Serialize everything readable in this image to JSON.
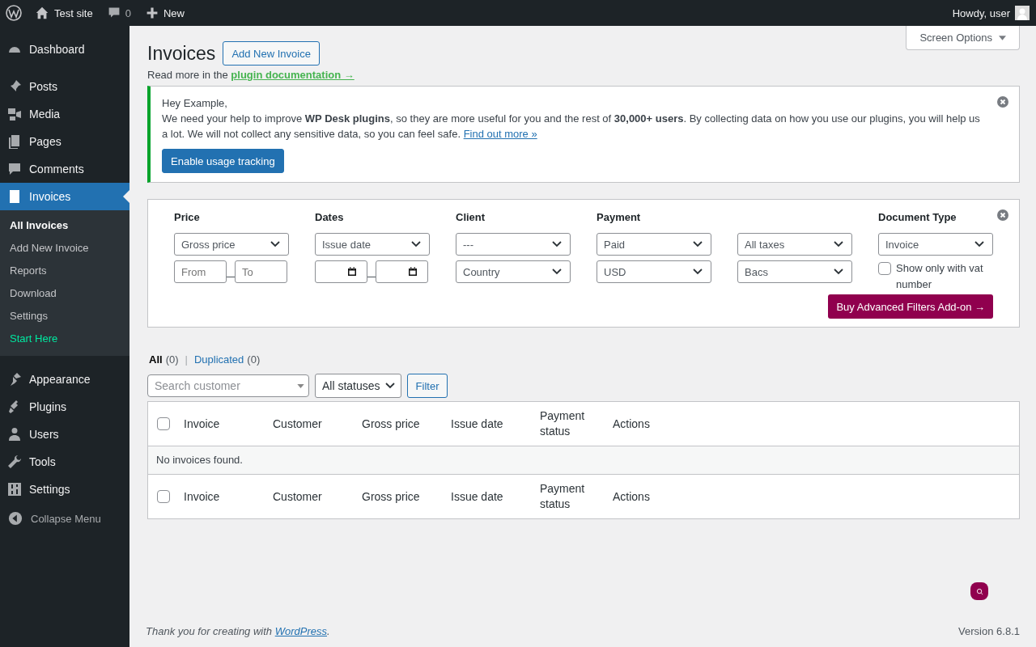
{
  "admin_bar": {
    "site": "Test site",
    "comments": "0",
    "new": "New",
    "greeting": "Howdy, user"
  },
  "sidebar": {
    "groups": [
      [
        {
          "label": "Dashboard",
          "selected": false
        }
      ],
      [
        {
          "label": "Posts",
          "selected": false
        },
        {
          "label": "Media",
          "selected": false
        },
        {
          "label": "Pages",
          "selected": false
        },
        {
          "label": "Comments",
          "selected": false
        },
        {
          "label": "Invoices",
          "selected": true,
          "children": [
            {
              "label": "All Invoices",
              "selected": true,
              "kind": "link"
            },
            {
              "label": "Add New Invoice",
              "selected": false,
              "kind": "link"
            },
            {
              "label": "Reports",
              "selected": false,
              "kind": "link"
            },
            {
              "label": "Download",
              "selected": false,
              "kind": "link"
            },
            {
              "label": "Settings",
              "selected": false,
              "kind": "link"
            },
            {
              "label": "Start Here",
              "selected": false,
              "kind": "promo"
            }
          ]
        }
      ],
      [
        {
          "label": "Appearance",
          "selected": false
        },
        {
          "label": "Plugins",
          "selected": false
        },
        {
          "label": "Users",
          "selected": false
        },
        {
          "label": "Tools",
          "selected": false
        },
        {
          "label": "Settings",
          "selected": false
        }
      ]
    ],
    "collapse": "Collapse Menu"
  },
  "screen_options": "Screen Options",
  "page": {
    "title": "Invoices",
    "add_new": "Add New Invoice",
    "read_more": "Read more in the",
    "doc_link": "plugin documentation →"
  },
  "notice": {
    "greeting": "Hey Example,",
    "message": "We need your help to improve **WP Desk plugins**, so they are more useful for you and the rest of **30,000+ users**. By collecting data on how you use our plugins, you will help us a lot. We will not collect any sensitive data, so you can feel safe.",
    "link": "Find out more »",
    "button": "Enable usage tracking"
  },
  "filters": {
    "columns": [
      {
        "heading": "Price",
        "controls": [
          {
            "kind": "select",
            "value": "Gross price"
          },
          {
            "kind": "range",
            "from": {
              "placeholder": "From"
            },
            "to": {
              "placeholder": "To"
            }
          }
        ]
      },
      {
        "heading": "Dates",
        "controls": [
          {
            "kind": "select",
            "value": "Issue date"
          },
          {
            "kind": "date_range"
          }
        ]
      },
      {
        "heading": "Client",
        "controls": [
          {
            "kind": "select",
            "value": "---"
          },
          {
            "kind": "select",
            "value": "Country"
          }
        ]
      },
      {
        "heading": "Payment",
        "controls": [
          {
            "kind": "select",
            "value": "Paid"
          },
          {
            "kind": "select",
            "value": "USD"
          }
        ]
      },
      {
        "controls": [
          {
            "kind": "select",
            "value": "All taxes"
          },
          {
            "kind": "select",
            "value": "Bacs"
          }
        ]
      },
      {
        "heading": "Document Type",
        "controls": [
          {
            "kind": "select",
            "value": "Invoice"
          },
          {
            "kind": "checkbox",
            "label": "Show only with vat number",
            "checked": false
          }
        ]
      }
    ],
    "buy_button": "Buy Advanced Filters Add-on →"
  },
  "views_separator": "|",
  "views": [
    {
      "label": "All",
      "count": "(0)",
      "selected": true
    },
    {
      "label": "Duplicated",
      "count": "(0)",
      "selected": false
    }
  ],
  "toolbar": {
    "search_placeholder": "Search customer",
    "status": "All statuses",
    "filter": "Filter"
  },
  "table": {
    "select_all_checked": false,
    "columns": [
      "Invoice",
      "Customer",
      "Gross price",
      "Issue date",
      "Payment status",
      "Actions"
    ],
    "empty": "No invoices found.",
    "footer_select_all_checked": false,
    "footer_columns": [
      "Invoice",
      "Customer",
      "Gross price",
      "Issue date",
      "Payment status",
      "Actions"
    ]
  },
  "footer": {
    "thanks": "Thank you for creating with",
    "link": "WordPress",
    "after": ".",
    "version": "Version 6.8.1"
  }
}
